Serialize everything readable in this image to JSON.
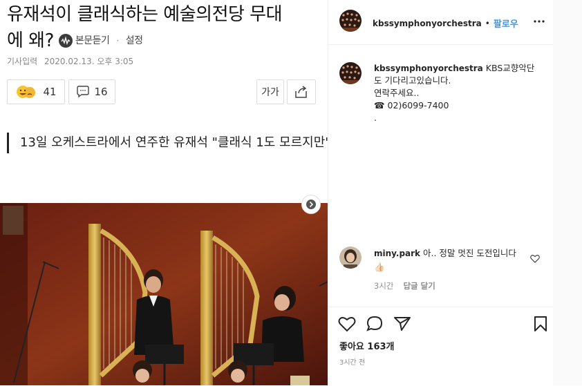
{
  "article": {
    "headline_line1": "유재석이 클래식하는 예술의전당 무대",
    "headline_line2": "에 왜?",
    "listen_label": "본문듣기",
    "settings_label": "설정",
    "date_label": "기사입력",
    "date_value": "2020.02.13. 오후 3:05",
    "reaction_count": "41",
    "comment_count": "16",
    "font_size_label": "가가",
    "quote_text": "13일 오케스트라에서 연주한 유재석 \"클래식 1도 모르지만\""
  },
  "instagram": {
    "header_username": "kbssymphonyorchestra",
    "follow_label": "팔로우",
    "caption_username": "kbssymphonyorchestra",
    "caption_line1": "KBS교향악단",
    "caption_line2": "도 기다리고있습니다.",
    "caption_line3": "연락주세요..",
    "caption_line4": "☎ 02)6099-7400",
    "caption_line5": ".",
    "comment_username": "miny.park",
    "comment_text": "아.. 정말 멋진 도전입니다👍🏻",
    "comment_time": "3시간",
    "reply_label": "답글 달기",
    "likes_text": "좋아요 163개",
    "post_time": "3시간 전"
  },
  "colors": {
    "follow_blue": "#3897f0",
    "muted_gray": "#8e8e8e"
  },
  "icons": [
    "sound-wave-icon",
    "emoji-reaction-icon",
    "speech-bubble-icon",
    "share-icon",
    "chevron-right-icon",
    "more-icon",
    "heart-icon",
    "comment-icon",
    "send-icon",
    "bookmark-icon"
  ]
}
